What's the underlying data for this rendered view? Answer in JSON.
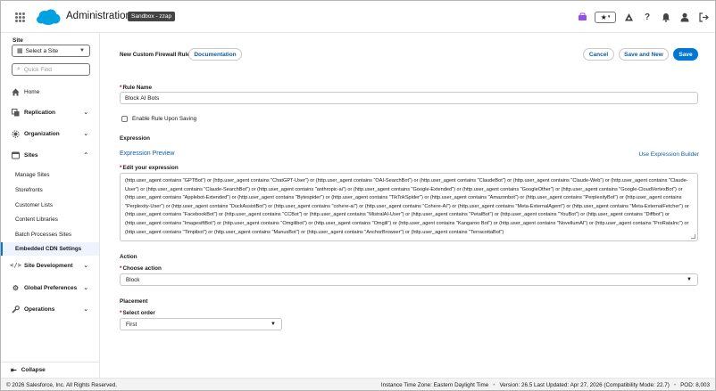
{
  "header": {
    "app_title": "Administration",
    "org_badge": "Sandbox - zzap",
    "icons": [
      "waffle-icon",
      "salesforce-cloud-logo",
      "store-icon",
      "favorites-icon",
      "setup-gear-icon",
      "help-icon",
      "notifications-icon",
      "user-icon",
      "logout-icon"
    ]
  },
  "sidebar": {
    "site_label": "Site",
    "site_select_value": "Select a Site",
    "quick_find_placeholder": "Quick Find",
    "items": [
      {
        "label": "Home",
        "icon": "home-icon"
      },
      {
        "label": "Replication",
        "icon": "replication-icon"
      },
      {
        "label": "Organization",
        "icon": "organization-icon"
      },
      {
        "label": "Sites",
        "icon": "sites-icon"
      },
      {
        "label": "Site Development",
        "icon": "code-icon"
      },
      {
        "label": "Global Preferences",
        "icon": "gear-icon"
      },
      {
        "label": "Operations",
        "icon": "wrench-icon"
      }
    ],
    "sites_sub": [
      "Manage Sites",
      "Storefronts",
      "Customer Lists",
      "Content Libraries",
      "Batch Processes Sites",
      "Embedded CDN Settings"
    ],
    "active_sub": "Embedded CDN Settings",
    "collapse_label": "Collapse"
  },
  "main": {
    "page_title": "New Custom Firewall Rule",
    "documentation_button": "Documentation",
    "cancel_button": "Cancel",
    "save_and_new_button": "Save and New",
    "save_button": "Save",
    "rule_name_label": "Rule Name",
    "rule_name_value": "Block AI Bots",
    "enable_checkbox_label": "Enable Rule Upon Saving",
    "expression_section": "Expression",
    "expression_preview_link": "Expression Preview",
    "expression_builder_link": "Use Expression Builder",
    "edit_expression_label": "Edit your expression",
    "expression_text": "(http.user_agent contains \"GPTBot\") or (http.user_agent contains \"ChatGPT-User\") or (http.user_agent contains \"OAI-SearchBot\") or (http.user_agent contains \"ClaudeBot\") or (http.user_agent contains \"Claude-Web\") or (http.user_agent contains \"Claude-User\") or (http.user_agent contains \"Claude-SearchBot\") or (http.user_agent contains \"anthropic-ai\") or (http.user_agent contains \"Google-Extended\") or (http.user_agent contains \"GoogleOther\") or (http.user_agent contains \"Google-CloudVertexBot\") or (http.user_agent contains \"Applebot-Extended\") or (http.user_agent contains \"Bytespider\") or (http.user_agent contains \"TikTokSpider\") or (http.user_agent contains \"Amazonbot\") or (http.user_agent contains \"PerplexityBot\") or (http.user_agent contains \"Perplexity-User\") or (http.user_agent contains \"DuckAssistBot\") or (http.user_agent contains \"cohere-ai\") or (http.user_agent contains \"Cohere-AI\") or (http.user_agent contains \"Meta-ExternalAgent\") or (http.user_agent contains \"Meta-ExternalFetcher\") or (http.user_agent contains \"FacebookBot\") or (http.user_agent contains \"CCBot\") or (http.user_agent contains \"MistralAI-User\") or (http.user_agent contains \"PetalBot\") or (http.user_agent contains \"YouBot\") or (http.user_agent contains \"Diffbot\") or (http.user_agent contains \"ImagesiftBot\") or (http.user_agent contains \"Omgilibot\") or (http.user_agent contains \"Omgili\") or (http.user_agent contains \"Kangaroo Bot\") or (http.user_agent contains \"NovellumAI\") or (http.user_agent contains \"ProRataInc\") or (http.user_agent contains \"Timpibot\") or (http.user_agent contains \"ManusBot\") or (http.user_agent contains \"AnchorBrowser\") or (http.user_agent contains \"TerracottaBot\")",
    "action_section": "Action",
    "choose_action_label": "Choose action",
    "choose_action_value": "Block",
    "placement_section": "Placement",
    "select_order_label": "Select order",
    "select_order_value": "First"
  },
  "footer": {
    "copyright": "© 2026 Salesforce, Inc. All Rights Reserved.",
    "timezone": "Instance Time Zone: Eastern Daylight Time",
    "version": "Version: 26.5 Last Updated: Apr 27, 2026 (Compatibility Mode: 22.7)",
    "pod": "POD: 8,003"
  },
  "colors": {
    "brand_blue": "#0176d3",
    "link_blue": "#0b5cab",
    "required_red": "#ba0517",
    "active_nav_bg": "#eef4ff"
  }
}
